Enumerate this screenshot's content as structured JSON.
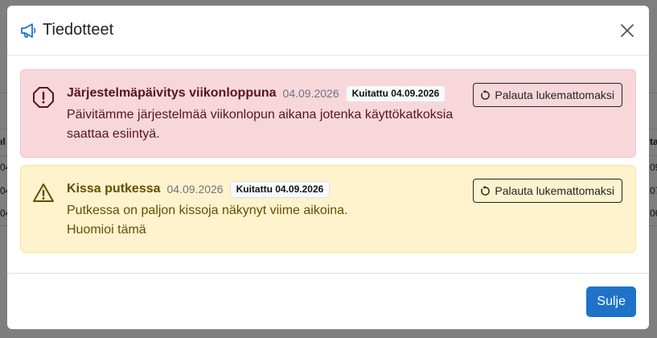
{
  "background": {
    "rows": [
      {
        "left": "ıl",
        "right": "ta"
      },
      {
        "left": "04",
        "right": "09"
      },
      {
        "left": "04",
        "right": "07"
      },
      {
        "left": "04",
        "right": "06"
      }
    ]
  },
  "modal": {
    "title": "Tiedotteet",
    "title_icon": "megaphone-icon",
    "close_icon": "close-icon",
    "footer": {
      "close_label": "Sulje"
    },
    "notices": [
      {
        "type": "danger",
        "icon": "exclamation-octagon-icon",
        "title": "Järjestelmäpäivitys viikonloppuna",
        "date": "04.09.2026",
        "badge": "Kuitattu 04.09.2026",
        "body_lines": [
          "Päivitämme järjestelmää viikonlopun aikana jotenka käyttökatkoksia",
          "saattaa esiintyä."
        ],
        "action_label": "Palauta lukemattomaksi",
        "action_icon": "restore-icon"
      },
      {
        "type": "warning",
        "icon": "exclamation-triangle-icon",
        "title": "Kissa putkessa",
        "date": "04.09.2026",
        "badge": "Kuitattu 04.09.2026",
        "body_lines": [
          "Putkessa on paljon kissoja näkynyt viime aikoina.",
          "Huomioi tämä"
        ],
        "action_label": "Palauta lukemattomaksi",
        "action_icon": "restore-icon"
      }
    ]
  },
  "colors": {
    "primary": "#1e73c8",
    "danger_bg": "#f8d7da",
    "warning_bg": "#fff3cd",
    "danger_text": "#58151c",
    "warning_text": "#664d03"
  }
}
